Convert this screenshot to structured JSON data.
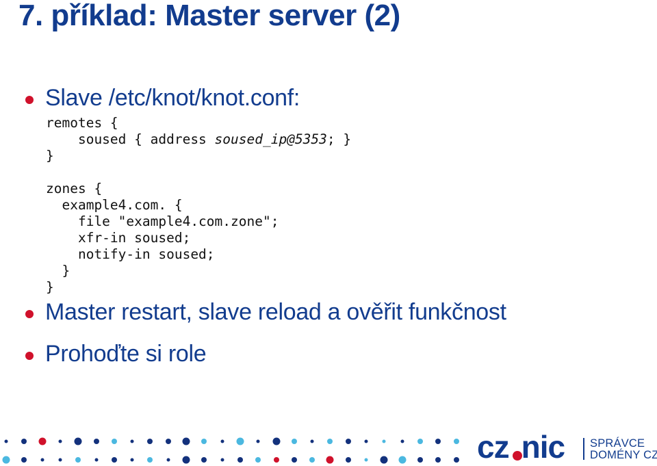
{
  "slide": {
    "title": "7. příklad: Master server (2)",
    "bullets": [
      {
        "text": "Slave /etc/knot/knot.conf:"
      },
      {
        "text": "Master restart, slave reload a ověřit funkčnost"
      },
      {
        "text": "Prohoďte si role"
      }
    ],
    "code": {
      "lines": [
        "remotes {",
        "    soused { address ",
        "}",
        "",
        "zones {",
        "  example4.com. {",
        "    file \"example4.com.zone\";",
        "    xfr-in soused;",
        "    notify-in soused;",
        "  }",
        "}"
      ],
      "remote_line_prefix": "    soused { address ",
      "remote_line_italic": "soused_ip@5353",
      "remote_line_suffix": "; }"
    }
  },
  "footer": {
    "logo_text": "cz.nic",
    "logo_cz": "cz",
    "logo_nic": "nic",
    "tagline_line1": "SPRÁVCE",
    "tagline_line2": "DOMÉNY CZ",
    "colors": {
      "navy": "#13317c",
      "light": "#4bb8e0",
      "red": "#d0112b"
    },
    "dot_rows": [
      [
        "s-n",
        "m-n",
        "l-r",
        "s-n",
        "l-n",
        "m-n",
        "m-l",
        "s-n",
        "m-n",
        "m-n",
        "l-n",
        "m-l",
        "s-n",
        "l-l",
        "s-n",
        "l-n",
        "m-l",
        "s-n",
        "m-l",
        "m-n",
        "s-n",
        "s-l",
        "s-n",
        "m-l",
        "m-n",
        "m-l"
      ],
      [
        "l-l",
        "m-n",
        "s-n",
        "s-n",
        "m-l",
        "s-n",
        "m-n",
        "s-n",
        "m-l",
        "s-n",
        "l-n",
        "m-n",
        "s-n",
        "m-n",
        "m-l",
        "m-r",
        "m-n",
        "m-l",
        "l-r",
        "m-n",
        "s-l",
        "l-n",
        "l-l",
        "m-n",
        "m-n",
        "m-n"
      ]
    ]
  }
}
